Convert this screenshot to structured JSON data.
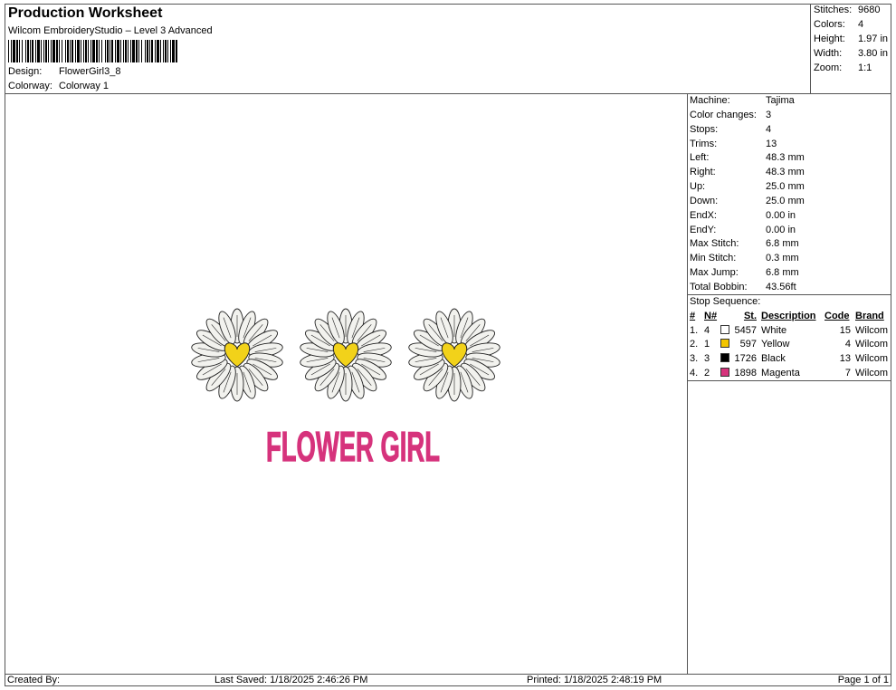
{
  "header": {
    "title": "Production Worksheet",
    "subtitle": "Wilcom EmbroideryStudio – Level 3 Advanced",
    "design_label": "Design:",
    "design_value": "FlowerGirl3_8",
    "colorway_label": "Colorway:",
    "colorway_value": "Colorway 1"
  },
  "summary": [
    {
      "label": "Stitches:",
      "value": "9680"
    },
    {
      "label": "Colors:",
      "value": "4"
    },
    {
      "label": "Height:",
      "value": "1.97 in"
    },
    {
      "label": "Width:",
      "value": "3.80 in"
    },
    {
      "label": "Zoom:",
      "value": "1:1"
    }
  ],
  "details": [
    {
      "label": "Machine:",
      "value": "Tajima"
    },
    {
      "label": "Color changes:",
      "value": "3"
    },
    {
      "label": "Stops:",
      "value": "4"
    },
    {
      "label": "Trims:",
      "value": "13"
    },
    {
      "label": "Left:",
      "value": "48.3 mm"
    },
    {
      "label": "Right:",
      "value": "48.3 mm"
    },
    {
      "label": "Up:",
      "value": "25.0 mm"
    },
    {
      "label": "Down:",
      "value": "25.0 mm"
    },
    {
      "label": "EndX:",
      "value": "0.00 in"
    },
    {
      "label": "EndY:",
      "value": "0.00 in"
    },
    {
      "label": "Max Stitch:",
      "value": "6.8 mm"
    },
    {
      "label": "Min Stitch:",
      "value": "0.3 mm"
    },
    {
      "label": "Max Jump:",
      "value": "6.8 mm"
    },
    {
      "label": "Total Bobbin:",
      "value": "43.56ft"
    }
  ],
  "stop_sequence": {
    "title": "Stop Sequence:",
    "columns": {
      "num": "#",
      "n": "N#",
      "st": "St.",
      "description": "Description",
      "code": "Code",
      "brand": "Brand"
    },
    "rows": [
      {
        "num": "1.",
        "n": "4",
        "color": "#ffffff",
        "st": "5457",
        "description": "White",
        "code": "15",
        "brand": "Wilcom"
      },
      {
        "num": "2.",
        "n": "1",
        "color": "#f2c500",
        "st": "597",
        "description": "Yellow",
        "code": "4",
        "brand": "Wilcom"
      },
      {
        "num": "3.",
        "n": "3",
        "color": "#000000",
        "st": "1726",
        "description": "Black",
        "code": "13",
        "brand": "Wilcom"
      },
      {
        "num": "4.",
        "n": "2",
        "color": "#d6337c",
        "st": "1898",
        "description": "Magenta",
        "code": "7",
        "brand": "Wilcom"
      }
    ]
  },
  "design_preview": {
    "text": "FLOWER GIRL",
    "text_color": "#d6337c",
    "petal_color": "#f2f2ee",
    "center_color": "#f2d21a",
    "outline_color": "#222222"
  },
  "footer": {
    "created_by": "Created By:",
    "last_saved": "Last Saved: 1/18/2025 2:46:26 PM",
    "printed": "Printed: 1/18/2025 2:48:19 PM",
    "page": "Page 1 of 1"
  }
}
